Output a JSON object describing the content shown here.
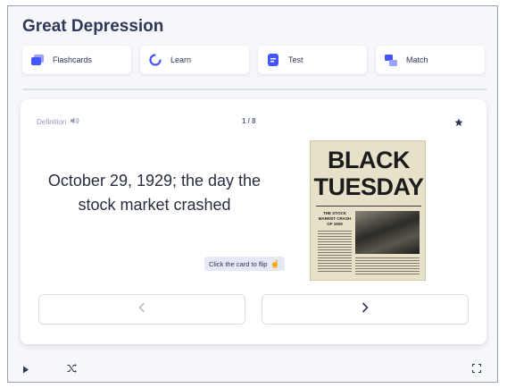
{
  "page": {
    "title": "Great Depression"
  },
  "modes": [
    {
      "label": "Flashcards",
      "icon": "flashcards-icon",
      "color": "#4255ff"
    },
    {
      "label": "Learn",
      "icon": "learn-icon",
      "color": "#4255ff"
    },
    {
      "label": "Test",
      "icon": "test-icon",
      "color": "#4255ff"
    },
    {
      "label": "Match",
      "icon": "match-icon",
      "color": "#4255ff"
    }
  ],
  "card": {
    "side_label": "Definition",
    "counter": "1 / 8",
    "text": "October 29, 1929; the day the stock market crashed",
    "hint": "Click the card to flip",
    "image": {
      "headline_1": "BLACK",
      "headline_2": "TUESDAY",
      "subhead": "THE STOCK MARKET CRASH OF 1929"
    }
  },
  "nav": {
    "prev_icon": "chevron-left-icon",
    "next_icon": "chevron-right-icon"
  },
  "toolbar": {
    "play_icon": "play-icon",
    "shuffle_icon": "shuffle-icon",
    "fullscreen_icon": "fullscreen-icon"
  },
  "colors": {
    "accent": "#4255ff",
    "text": "#2e3856",
    "muted": "#939bb4",
    "bg": "#f6f7fb"
  }
}
